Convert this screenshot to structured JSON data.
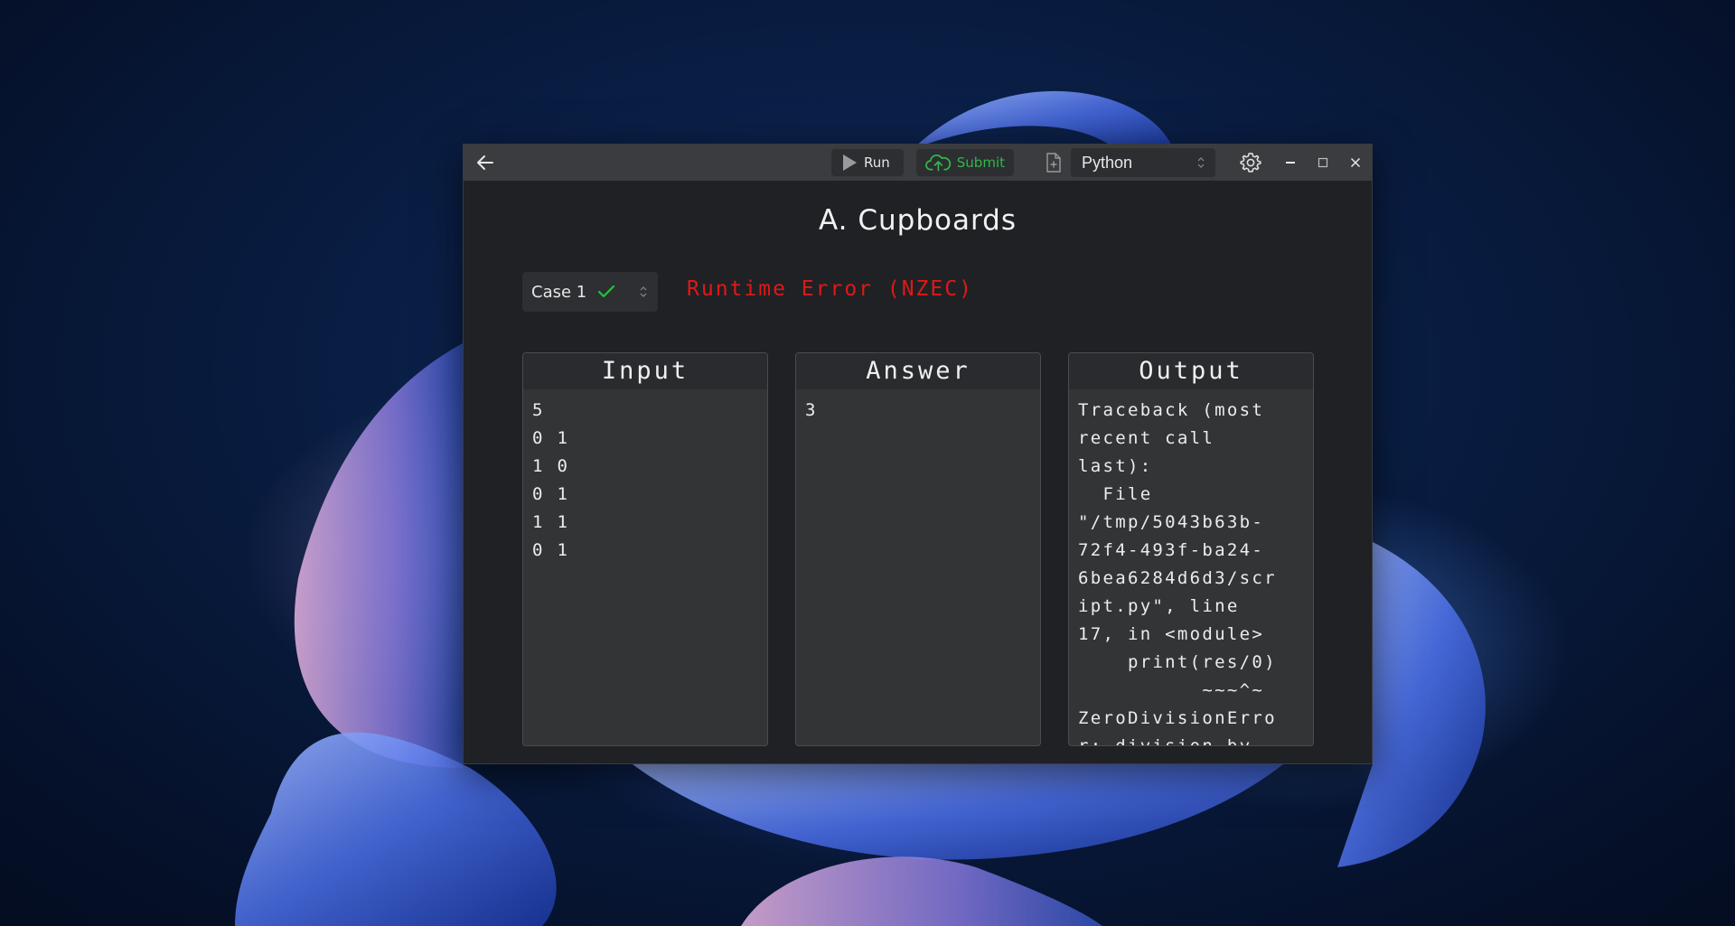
{
  "window": {
    "title": "A. Cupboards",
    "toolbar": {
      "back_icon": "arrow-left-icon",
      "run_label": "Run",
      "submit_label": "Submit",
      "language": "Python",
      "settings_icon": "gear-icon"
    }
  },
  "test_case": {
    "selected": "Case 1",
    "passed_icon": "checkmark-icon",
    "status": "Runtime Error (NZEC)"
  },
  "panels": {
    "input": {
      "heading": "Input",
      "content": "5\n0 1\n1 0\n0 1\n1 1\n0 1"
    },
    "answer": {
      "heading": "Answer",
      "content": "3"
    },
    "output": {
      "heading": "Output",
      "content": "Traceback (most\nrecent call\nlast):\n  File\n\"/tmp/5043b63b-\n72f4-493f-ba24-\n6bea6284d6d3/scr\nipt.py\", line\n17, in <module>\n    print(res/0)\n          ~~~^~\nZeroDivisionErro\nr: division by\nzero"
    }
  },
  "colors": {
    "status_error": "#e01818",
    "submit_green": "#2eb84a",
    "check_green": "#22c43a"
  }
}
